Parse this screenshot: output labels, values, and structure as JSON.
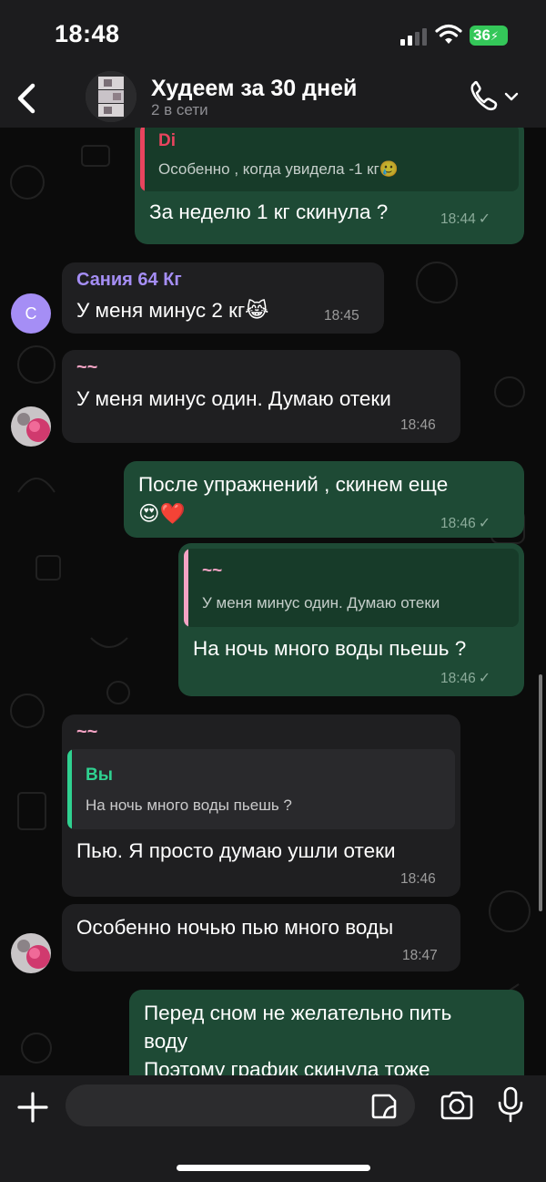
{
  "status_bar": {
    "time": "18:48",
    "battery": "36"
  },
  "header": {
    "title": "Худеем за 30 дней",
    "subtitle": "2 в сети",
    "icons": [
      "back-icon",
      "phone-icon",
      "chevron-down-icon"
    ]
  },
  "colors": {
    "outgoing_bubble": "#1e4a35",
    "incoming_bubble": "#1f1f21",
    "sender_sania": "#a58ef5",
    "sender_tilde": "#f4a3c4",
    "quote_di": "#e8445e",
    "quote_you": "#2fd190",
    "quote_tilde": "#f4a3c4"
  },
  "messages": [
    {
      "direction": "out",
      "quote_author": "Di",
      "quote_text": "Особенно , когда увидела -1 кг🥲",
      "text": "За неделю 1 кг скинула ?",
      "time": "18:44",
      "status": "✓"
    },
    {
      "direction": "in",
      "sender": "Сания 64 Кг",
      "avatar_letter": "С",
      "text": "У меня минус 2 кг😹",
      "time": "18:45"
    },
    {
      "direction": "in",
      "sender": "~~",
      "text": "У меня минус один. Думаю отеки",
      "time": "18:46"
    },
    {
      "direction": "out",
      "text_line1": "После упражнений , скинем еще",
      "text_line2": "😍❤️",
      "time": "18:46",
      "status": "✓"
    },
    {
      "direction": "out",
      "quote_author": "~~",
      "quote_text": "У меня минус один. Думаю отеки",
      "text": "На ночь много воды пьешь ?",
      "time": "18:46",
      "status": "✓"
    },
    {
      "direction": "in",
      "sender": "~~",
      "quote_author": "Вы",
      "quote_text": "На ночь много воды пьешь ?",
      "text": "Пью. Я просто думаю ушли отеки",
      "time": "18:46"
    },
    {
      "direction": "in",
      "text": "Особенно ночью пью много воды",
      "time": "18:47"
    },
    {
      "direction": "out",
      "text_line1": "Перед сном не желательно пить",
      "text_line2": "воду",
      "text_line3": "Поэтому график скинула тоже"
    }
  ],
  "input": {
    "placeholder": ""
  }
}
